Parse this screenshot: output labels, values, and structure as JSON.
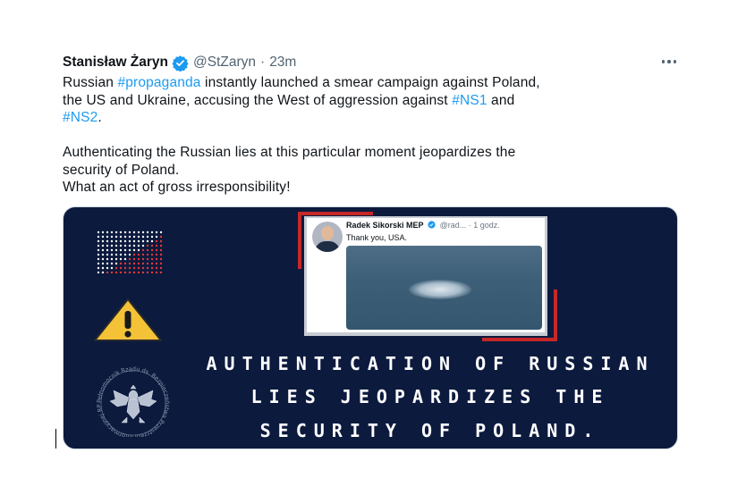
{
  "tweet": {
    "author_name": "Stanisław Żaryn",
    "handle": "@StZaryn",
    "separator": "·",
    "time": "23m",
    "body": {
      "l1_a": "Russian ",
      "l1_tag": "#propaganda",
      "l1_b": " instantly launched a smear campaign against Poland,",
      "l2_a": "the US and Ukraine, accusing the West of aggression against ",
      "l2_tag": "#NS1",
      "l2_b": " and",
      "l3_tag": "#NS2",
      "l3_b": ".",
      "p2": "Authenticating the Russian lies at this particular moment jeopardizes the",
      "p3": "security of Poland.",
      "p4": "What an act of gross irresponsibility!"
    }
  },
  "media": {
    "embedded_tweet": {
      "author": "Radek Sikorski MEP",
      "handle_time": "@rad... · 1 godz.",
      "text": "Thank you, USA."
    },
    "headline": {
      "line1": "AUTHENTICATION OF RUSSIAN",
      "line2": "LIES JEOPARDIZES THE",
      "line3": "SECURITY OF POLAND."
    },
    "seal_text": "Pełnomocnik Rządu ds. Bezpieczeństwa Przestrzeni Informacyjnej RP"
  },
  "icons": {
    "verified": "verified-badge-icon",
    "more": "more-options-icon",
    "warning": "warning-icon",
    "eagle": "polish-eagle-emblem-icon"
  },
  "colors": {
    "link": "#1d9bf0",
    "verified": "#1d9bf0",
    "media_bg": "#0c1a3e",
    "frame_red": "#c62828",
    "warning_yellow": "#f3c237"
  }
}
